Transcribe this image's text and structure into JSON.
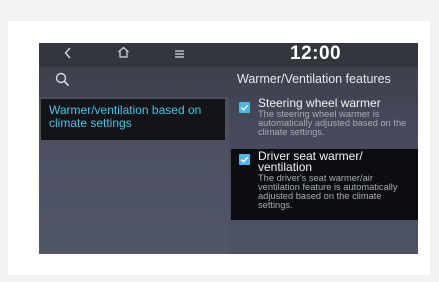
{
  "topbar": {
    "back_icon": "back-chevron-icon",
    "home_icon": "home-icon",
    "menu_icon": "menu-icon",
    "time": "12:00"
  },
  "header": {
    "search_icon": "search-icon",
    "title": "Warmer/Ventilation features"
  },
  "left_menu": {
    "items": [
      {
        "label": "Warmer/ventilation based on climate settings",
        "selected": true
      }
    ]
  },
  "options": [
    {
      "title": "Steering wheel warmer",
      "description": "The steering wheel warmer is automatically adjusted based on the climate settings.",
      "checked": true
    },
    {
      "title": "Driver seat warmer/ ventilation",
      "description": "The driver's seat warmer/air ventilation feature is automatically adjusted based on the climate settings.",
      "checked": true
    }
  ],
  "colors": {
    "accent": "#48c4e6",
    "checkbox": "#4fb6e3",
    "highlight_bg": "#0c0d10"
  }
}
